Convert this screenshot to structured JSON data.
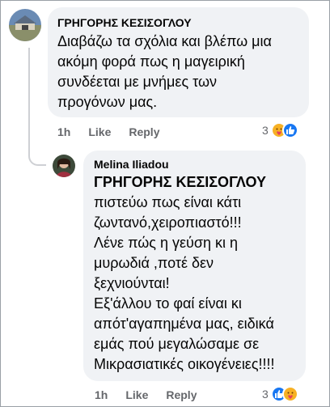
{
  "comment1": {
    "author": "ΓΡΗΓΟΡΗΣ ΚΕΣΙΣΟΓΛΟΥ",
    "lines": [
      "Διαβάζω τα σχόλια και βλέπω μια",
      "ακόμη φορά πως η μαγειρική",
      "συνδέεται με μνήμες των",
      "προγόνων μας."
    ],
    "time": "1h",
    "like_label": "Like",
    "reply_label": "Reply",
    "reaction_count": "3"
  },
  "reply1": {
    "author": "Melina Iliadou",
    "mention": "ΓΡΗΓΟΡΗΣ ΚΕΣΙΣΟΓΛΟΥ",
    "lines": [
      "πιστεύω πως είναι κάτι",
      "ζωντανό,χειροπιαστό!!!",
      "Λένε πώς η γεύση κι η",
      "μυρωδιά ,ποτέ δεν",
      "ξεχνιούνται!",
      "Εξ'άλλου το φαί είναι κι",
      "απότ'αγαπημένα μας, ειδικά",
      "εμάς πού μεγαλώσαμε σε",
      "Μικρασιατικές οικογένειες!!!!"
    ],
    "time": "1h",
    "like_label": "Like",
    "reply_label": "Reply",
    "reaction_count": "3"
  },
  "colors": {
    "bubble": "#f0f2f5",
    "meta": "#65676b",
    "like": "#1877f2",
    "care": "#f7b125"
  },
  "icons": {
    "care": "care-reaction-icon",
    "like": "like-reaction-icon"
  }
}
